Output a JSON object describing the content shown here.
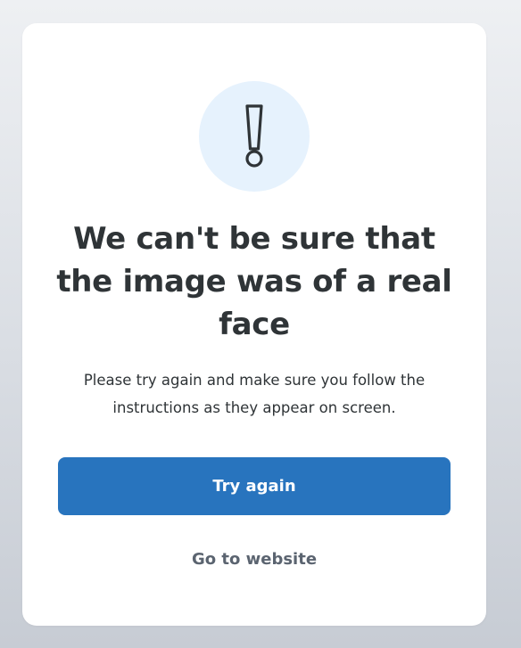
{
  "dialog": {
    "icon": "exclamation-icon",
    "title": "We can't be sure that the image was of a real face",
    "message": "Please try again and make sure you follow the instructions as they appear on screen.",
    "primary_button_label": "Try again",
    "secondary_link_label": "Go to website"
  },
  "colors": {
    "accent": "#2874be",
    "icon_background": "#e6f2fd",
    "text": "#2f3437",
    "link": "#5b6470"
  }
}
